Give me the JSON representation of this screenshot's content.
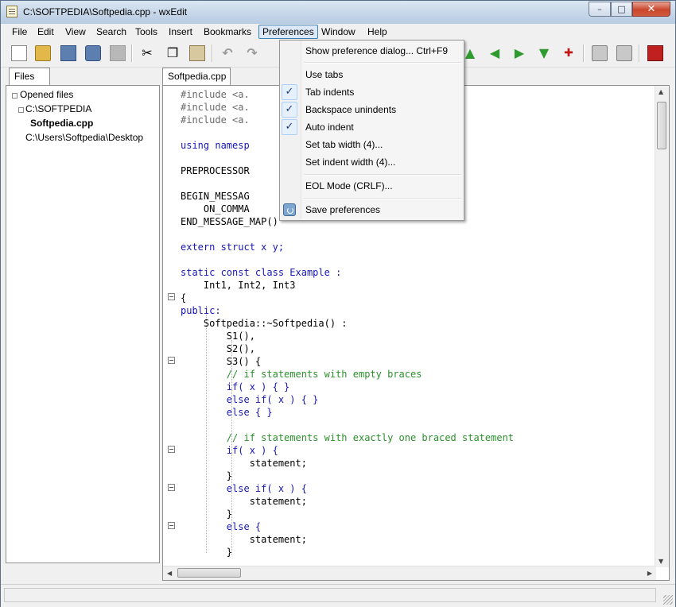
{
  "window": {
    "title": "C:\\SOFTPEDIA\\Softpedia.cpp - wxEdit"
  },
  "window_controls": {
    "minimize": "–",
    "maximize": "□",
    "close": "✕"
  },
  "menu": [
    "File",
    "Edit",
    "View",
    "Search",
    "Tools",
    "Insert",
    "Bookmarks",
    "Preferences",
    "Window",
    "Help"
  ],
  "toolbar": {
    "icons": [
      "new-file-icon",
      "open-file-icon",
      "save-icon",
      "save-as-icon",
      "close-file-icon",
      "cut-icon",
      "copy-icon",
      "paste-icon",
      "undo-icon",
      "redo-icon",
      "bookmark-up-icon",
      "bookmark-left-icon",
      "bookmark-right-icon",
      "bookmark-down-icon",
      "toggle-bookmark-icon",
      "print-icon",
      "print-preview-icon",
      "exit-icon"
    ]
  },
  "files_panel": {
    "tab_label": "Files",
    "tree": [
      {
        "label": "Opened files",
        "level": 0
      },
      {
        "label": "C:\\SOFTPEDIA",
        "level": 1
      },
      {
        "label": "Softpedia.cpp",
        "level": 2,
        "bold": true
      },
      {
        "label": "C:\\Users\\Softpedia\\Desktop",
        "level": 1
      }
    ]
  },
  "editor": {
    "tab_label": "Softpedia.cpp",
    "lines": [
      "#include <a.",
      "#include <a.",
      "#include <a.",
      "",
      "using namesp",
      "",
      "PREPROCESSOR",
      "",
      "BEGIN_MESSAG",
      "    ON_COMMA",
      "END_MESSAGE_MAP()",
      "",
      "extern struct x y;",
      "",
      "static const class Example :",
      "    Int1, Int2, Int3",
      "{",
      "public:",
      "    Softpedia::~Softpedia() :",
      "        S1(),",
      "        S2(),",
      "        S3() {",
      "        // if statements with empty braces",
      "        if( x ) { }",
      "        else if( x ) { }",
      "        else { }",
      "",
      "        // if statements with exactly one braced statement",
      "        if( x ) {",
      "            statement;",
      "        }",
      "        else if( x ) {",
      "            statement;",
      "        }",
      "        else {",
      "            statement;",
      "        }"
    ]
  },
  "preferences_menu": {
    "items": [
      {
        "label": "Show preference dialog...",
        "shortcut": "Ctrl+F9",
        "checked": false
      },
      {
        "label": "Use tabs",
        "checked": false
      },
      {
        "label": "Tab indents",
        "checked": true
      },
      {
        "label": "Backspace unindents",
        "checked": true
      },
      {
        "label": "Auto indent",
        "checked": true
      },
      {
        "label": "Set tab width (4)...",
        "checked": false
      },
      {
        "label": "Set indent width (4)...",
        "checked": false
      },
      {
        "label": "EOL Mode (CRLF)...",
        "checked": false
      },
      {
        "label": "Save preferences",
        "checked": false,
        "icon": "save-preferences-icon"
      }
    ],
    "check_glyph": "✓"
  },
  "status": {
    "text": ""
  }
}
